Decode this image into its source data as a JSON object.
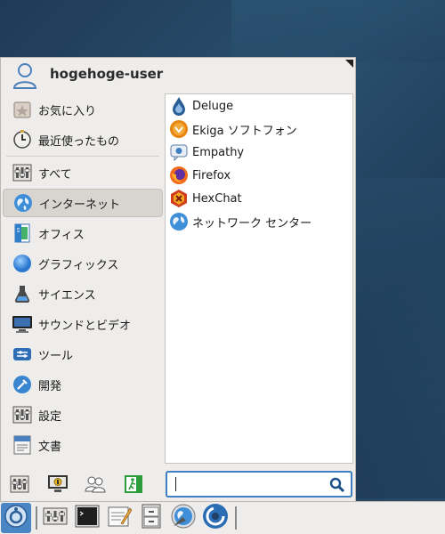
{
  "user": {
    "name": "hogehoge-user"
  },
  "categories": [
    {
      "label": "お気に入り",
      "icon": "favorites-icon"
    },
    {
      "label": "最近使ったもの",
      "icon": "recent-icon"
    },
    {
      "label": "すべて",
      "icon": "all-apps-icon"
    },
    {
      "label": "インターネット",
      "icon": "internet-icon",
      "active": true
    },
    {
      "label": "オフィス",
      "icon": "office-icon"
    },
    {
      "label": "グラフィックス",
      "icon": "graphics-icon"
    },
    {
      "label": "サイエンス",
      "icon": "science-icon"
    },
    {
      "label": "サウンドとビデオ",
      "icon": "sound-video-icon"
    },
    {
      "label": "ツール",
      "icon": "tools-icon"
    },
    {
      "label": "開発",
      "icon": "development-icon"
    },
    {
      "label": "設定",
      "icon": "settings-icon"
    },
    {
      "label": "文書",
      "icon": "documents-icon"
    }
  ],
  "apps": [
    {
      "label": "Deluge",
      "icon": "deluge-icon"
    },
    {
      "label": "Ekiga ソフトフォン",
      "icon": "ekiga-icon"
    },
    {
      "label": "Empathy",
      "icon": "empathy-icon"
    },
    {
      "label": "Firefox",
      "icon": "firefox-icon"
    },
    {
      "label": "HexChat",
      "icon": "hexchat-icon"
    },
    {
      "label": "ネットワーク センター",
      "icon": "network-center-icon"
    }
  ],
  "search": {
    "value": "",
    "placeholder": ""
  },
  "bottom_actions": [
    "settings-manager-icon",
    "lock-screen-icon",
    "switch-user-icon",
    "logout-icon"
  ],
  "taskbar": [
    "start-menu-icon",
    "settings-manager-icon",
    "terminal-icon",
    "text-editor-icon",
    "file-manager-icon",
    "web-browser-icon",
    "update-manager-icon"
  ],
  "colors": {
    "accent": "#3f7ec0",
    "active_bg": "#d8d5d1"
  }
}
